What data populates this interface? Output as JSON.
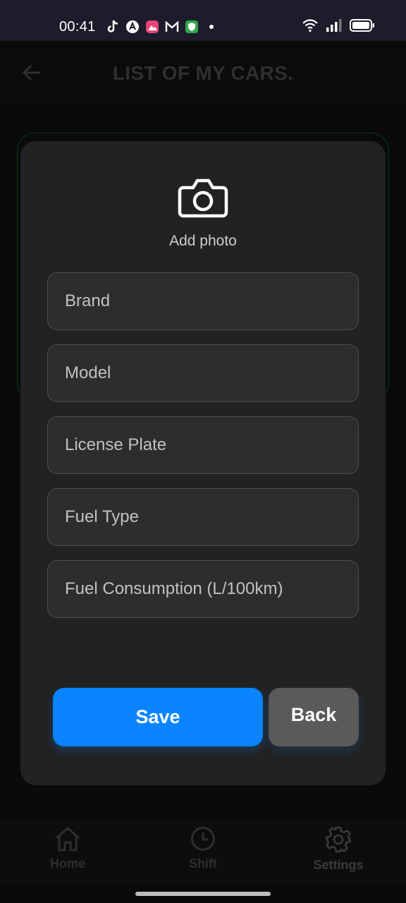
{
  "status_bar": {
    "time": "00:41",
    "apps": [
      "tiktok-icon",
      "arc-icon",
      "photo-app-icon",
      "gmail-icon",
      "vpn-shield-icon",
      "dot-icon"
    ],
    "indicators": [
      "wifi-icon",
      "signal-icon",
      "battery-icon"
    ]
  },
  "app_bar": {
    "title": "LIST OF MY CARS."
  },
  "modal": {
    "add_photo_label": "Add photo",
    "fields": {
      "brand": {
        "placeholder": "Brand",
        "value": ""
      },
      "model": {
        "placeholder": "Model",
        "value": ""
      },
      "license_plate": {
        "placeholder": "License Plate",
        "value": ""
      },
      "fuel_type": {
        "placeholder": "Fuel Type",
        "value": ""
      },
      "fuel_consumption": {
        "placeholder": "Fuel Consumption (L/100km)",
        "value": ""
      }
    },
    "save_label": "Save",
    "back_label": "Back"
  },
  "bottom_nav": {
    "items": [
      {
        "label": "Home",
        "icon": "home-icon"
      },
      {
        "label": "Shift",
        "icon": "clock-icon"
      },
      {
        "label": "Settings",
        "icon": "gear-icon"
      }
    ]
  },
  "colors": {
    "accent": "#0a84ff",
    "modal_bg": "#222222",
    "field_bg": "#2d2d2d",
    "back_button": "#5a5a5a",
    "status_bar_bg": "#1c1c2a"
  }
}
